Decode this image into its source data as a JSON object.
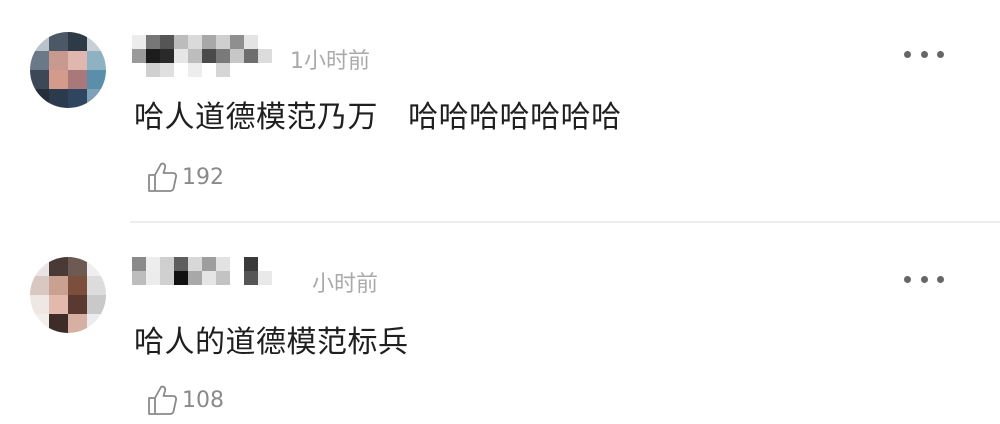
{
  "comments": [
    {
      "time": "1小时前",
      "text": "哈人道德模范乃万   哈哈哈哈哈哈哈",
      "likes": "192"
    },
    {
      "time": "小时前",
      "text": "哈人的道德模范标兵",
      "likes": "108"
    }
  ],
  "icons": {
    "more": "more-dots-icon",
    "like": "thumbs-up-icon"
  },
  "colors": {
    "text": "#1f1f1f",
    "meta": "#aaaaaa",
    "like": "#8a8a8a"
  }
}
